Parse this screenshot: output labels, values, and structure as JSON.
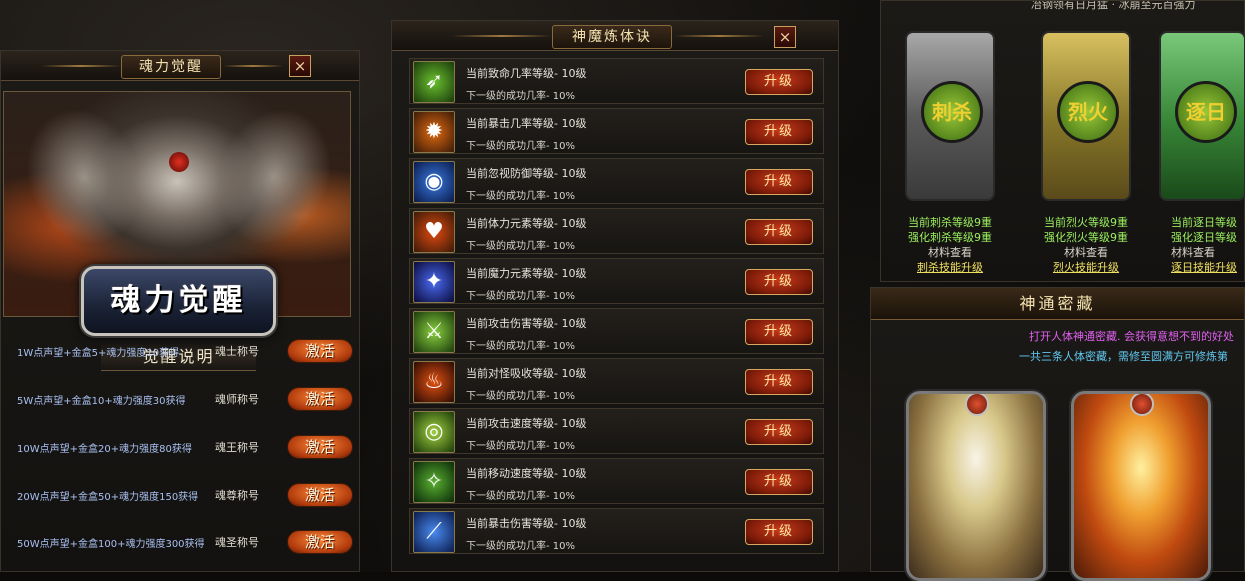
{
  "left_panel": {
    "title": "魂力觉醒",
    "close": "×",
    "banner": "魂力觉醒",
    "subtitle": "觉醒说明",
    "rows": [
      {
        "desc": "1W点声望+金盒5+魂力强度10获得",
        "title": "魂士称号",
        "button": "激活"
      },
      {
        "desc": "5W点声望+金盒10+魂力强度30获得",
        "title": "魂师称号",
        "button": "激活"
      },
      {
        "desc": "10W点声望+金盒20+魂力强度80获得",
        "title": "魂王称号",
        "button": "激活"
      },
      {
        "desc": "20W点声望+金盒50+魂力强度150获得",
        "title": "魂尊称号",
        "button": "激活"
      },
      {
        "desc": "50W点声望+金盒100+魂力强度300获得",
        "title": "魂圣称号",
        "button": "激活"
      }
    ]
  },
  "mid_panel": {
    "title": "神魔炼体诀",
    "close": "×",
    "skills": [
      {
        "icon": "arrow-icon",
        "level": "当前致命几率等级- 10级",
        "rate": "下一级的成功几率- 10%",
        "button": "升级"
      },
      {
        "icon": "flame-slash-icon",
        "level": "当前暴击几率等级- 10级",
        "rate": "下一级的成功几率- 10%",
        "button": "升级"
      },
      {
        "icon": "shield-ignore-icon",
        "level": "当前忽视防御等级- 10级",
        "rate": "下一级的成功几率- 10%",
        "button": "升级"
      },
      {
        "icon": "heart-icon",
        "level": "当前体力元素等级- 10级",
        "rate": "下一级的成功几率- 10%",
        "button": "升级"
      },
      {
        "icon": "blue-flame-icon",
        "level": "当前魔力元素等级- 10级",
        "rate": "下一级的成功几率- 10%",
        "button": "升级"
      },
      {
        "icon": "sword-slash-icon",
        "level": "当前攻击伤害等级- 10级",
        "rate": "下一级的成功几率- 10%",
        "button": "升级"
      },
      {
        "icon": "fire-figure-icon",
        "level": "当前对怪吸收等级- 10级",
        "rate": "下一级的成功几率- 10%",
        "button": "升级"
      },
      {
        "icon": "wind-swirl-icon",
        "level": "当前攻击速度等级- 10级",
        "rate": "下一级的成功几率- 10%",
        "button": "升级"
      },
      {
        "icon": "running-figure-icon",
        "level": "当前移动速度等级- 10级",
        "rate": "下一级的成功几率- 10%",
        "button": "升级"
      },
      {
        "icon": "blue-slash-icon",
        "level": "当前暴击伤害等级- 10级",
        "rate": "下一级的成功几率- 10%",
        "button": "升级"
      }
    ]
  },
  "right_top": {
    "caption": "冶钢领有日月猛 · 冰崩至元百强力",
    "emblems": [
      {
        "name": "刺杀",
        "current": "当前刺杀等级9重",
        "enhance": "强化刺杀等级9重",
        "material": "材料查看",
        "upgrade": "刺杀技能升级",
        "color": "#8a8a8a"
      },
      {
        "name": "烈火",
        "current": "当前烈火等级9重",
        "enhance": "强化烈火等级9重",
        "material": "材料查看",
        "upgrade": "烈火技能升级",
        "color": "#b8a040"
      },
      {
        "name": "逐日",
        "current": "当前逐日等级",
        "enhance": "强化逐日等级",
        "material": "材料查看",
        "upgrade": "逐日技能升级",
        "color": "#4a9a4a"
      }
    ]
  },
  "right_bottom": {
    "title": "神通密藏",
    "line1": "打开人体神通密藏. 会获得意想不到的好处",
    "line2": "一共三条人体密藏，需修至圆满方可修炼第"
  }
}
